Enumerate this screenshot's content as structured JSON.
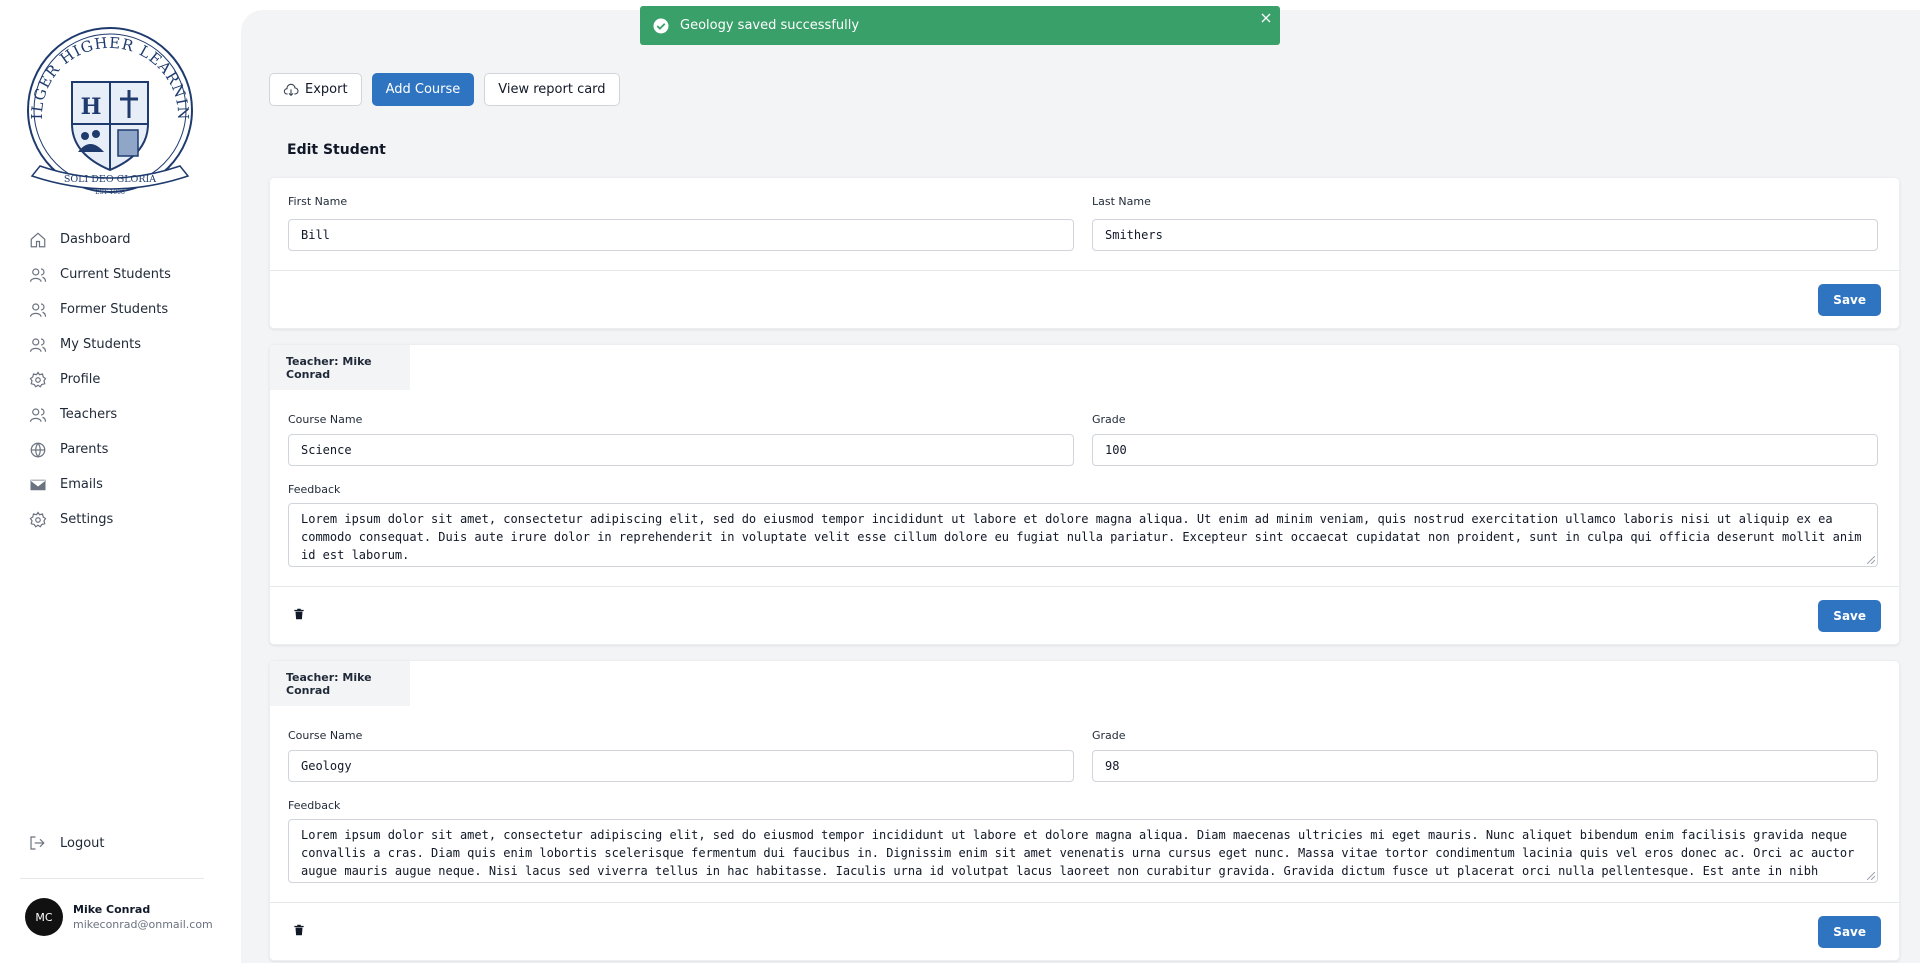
{
  "school": {
    "name_arc": "HILGER HIGHER LEARNING",
    "motto": "SOLI DEO GLORIA",
    "established": "EST 1998"
  },
  "sidebar": {
    "items": [
      {
        "label": "Dashboard",
        "icon": "home-icon"
      },
      {
        "label": "Current Students",
        "icon": "users-icon"
      },
      {
        "label": "Former Students",
        "icon": "users-icon"
      },
      {
        "label": "My Students",
        "icon": "users-icon"
      },
      {
        "label": "Profile",
        "icon": "gear-icon"
      },
      {
        "label": "Teachers",
        "icon": "users-icon"
      },
      {
        "label": "Parents",
        "icon": "globe-icon"
      },
      {
        "label": "Emails",
        "icon": "envelope-icon"
      },
      {
        "label": "Settings",
        "icon": "gear-icon"
      }
    ],
    "logout": "Logout"
  },
  "user": {
    "initials": "MC",
    "name": "Mike Conrad",
    "email": "mikeconrad@onmail.com"
  },
  "toast": {
    "message": "Geology saved successfully",
    "color": "#3aa06a"
  },
  "toolbar": {
    "export": "Export",
    "add_course": "Add Course",
    "view_report_card": "View report card"
  },
  "student": {
    "section_title": "Edit Student",
    "first_name_label": "First Name",
    "first_name": "Bill",
    "last_name_label": "Last Name",
    "last_name": "Smithers",
    "save": "Save"
  },
  "courses": [
    {
      "teacher": "Teacher: Mike Conrad",
      "course_label": "Course Name",
      "course": "Science",
      "grade_label": "Grade",
      "grade": "100",
      "feedback_label": "Feedback",
      "feedback": "Lorem ipsum dolor sit amet, consectetur adipiscing elit, sed do eiusmod tempor incididunt ut labore et dolore magna aliqua. Ut enim ad minim veniam, quis nostrud exercitation ullamco laboris nisi ut aliquip ex ea commodo consequat. Duis aute irure dolor in reprehenderit in voluptate velit esse cillum dolore eu fugiat nulla pariatur. Excepteur sint occaecat cupidatat non proident, sunt in culpa qui officia deserunt mollit anim id est laborum.",
      "save": "Save"
    },
    {
      "teacher": "Teacher: Mike Conrad",
      "course_label": "Course Name",
      "course": "Geology",
      "grade_label": "Grade",
      "grade": "98",
      "feedback_label": "Feedback",
      "feedback": "Lorem ipsum dolor sit amet, consectetur adipiscing elit, sed do eiusmod tempor incididunt ut labore et dolore magna aliqua. Diam maecenas ultricies mi eget mauris. Nunc aliquet bibendum enim facilisis gravida neque convallis a cras. Diam quis enim lobortis scelerisque fermentum dui faucibus in. Dignissim enim sit amet venenatis urna cursus eget nunc. Massa vitae tortor condimentum lacinia quis vel eros donec ac. Orci ac auctor augue mauris augue neque. Nisi lacus sed viverra tellus in hac habitasse. Iaculis urna id volutpat lacus laoreet non curabitur gravida. Gravida dictum fusce ut placerat orci nulla pellentesque. Est ante in nibh mauris. Nibh mauris cursus mattis molestie a iaculis.",
      "save": "Save"
    }
  ],
  "colors": {
    "primary": "#2f74c0",
    "success": "#3aa06a"
  }
}
